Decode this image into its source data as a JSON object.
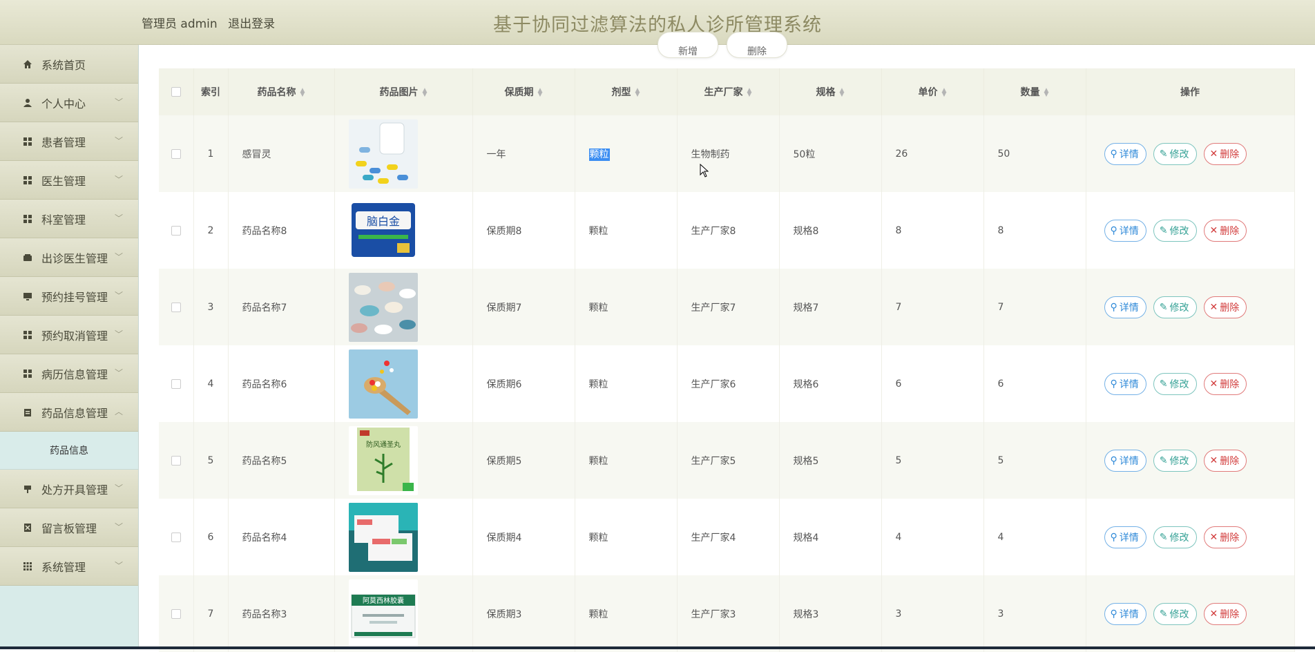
{
  "header": {
    "user_prefix": "管理员 admin",
    "logout": "退出登录",
    "title": "基于协同过滤算法的私人诊所管理系统"
  },
  "top_buttons": {
    "left": "新增",
    "right": "删除"
  },
  "sidebar": {
    "items": [
      {
        "label": "系统首页",
        "icon": "home-icon",
        "chevron": false
      },
      {
        "label": "个人中心",
        "icon": "user-icon",
        "chevron": true
      },
      {
        "label": "患者管理",
        "icon": "grid-icon",
        "chevron": true
      },
      {
        "label": "医生管理",
        "icon": "grid-icon",
        "chevron": true
      },
      {
        "label": "科室管理",
        "icon": "grid-icon",
        "chevron": true
      },
      {
        "label": "出诊医生管理",
        "icon": "wallet-icon",
        "chevron": true
      },
      {
        "label": "预约挂号管理",
        "icon": "monitor-icon",
        "chevron": true
      },
      {
        "label": "预约取消管理",
        "icon": "grid-icon",
        "chevron": true
      },
      {
        "label": "病历信息管理",
        "icon": "grid-icon",
        "chevron": true
      },
      {
        "label": "药品信息管理",
        "icon": "clipboard-icon",
        "chevron": true,
        "expanded": true
      },
      {
        "label": "处方开具管理",
        "icon": "stamp-icon",
        "chevron": true
      },
      {
        "label": "留言板管理",
        "icon": "note-icon",
        "chevron": true
      },
      {
        "label": "系统管理",
        "icon": "apps-icon",
        "chevron": true
      }
    ],
    "sub_item": "药品信息"
  },
  "table": {
    "headers": [
      "索引",
      "药品名称",
      "药品图片",
      "保质期",
      "剂型",
      "生产厂家",
      "规格",
      "单价",
      "数量",
      "操作"
    ],
    "rows": [
      {
        "idx": "1",
        "name": "感冒灵",
        "image": "capsules-bottle",
        "period": "一年",
        "form": "颗粒",
        "maker": "生物制药",
        "spec": "50粒",
        "price": "26",
        "qty": "50"
      },
      {
        "idx": "2",
        "name": "药品名称8",
        "image": "blue-box",
        "period": "保质期8",
        "form": "颗粒",
        "maker": "生产厂家8",
        "spec": "规格8",
        "price": "8",
        "qty": "8"
      },
      {
        "idx": "3",
        "name": "药品名称7",
        "image": "pills-closeup",
        "period": "保质期7",
        "form": "颗粒",
        "maker": "生产厂家7",
        "spec": "规格7",
        "price": "7",
        "qty": "7"
      },
      {
        "idx": "4",
        "name": "药品名称6",
        "image": "spoon-pills",
        "period": "保质期6",
        "form": "颗粒",
        "maker": "生产厂家6",
        "spec": "规格6",
        "price": "6",
        "qty": "6"
      },
      {
        "idx": "5",
        "name": "药品名称5",
        "image": "green-box",
        "period": "保质期5",
        "form": "颗粒",
        "maker": "生产厂家5",
        "spec": "规格5",
        "price": "5",
        "qty": "5"
      },
      {
        "idx": "6",
        "name": "药品名称4",
        "image": "teal-boxes",
        "period": "保质期4",
        "form": "颗粒",
        "maker": "生产厂家4",
        "spec": "规格4",
        "price": "4",
        "qty": "4"
      },
      {
        "idx": "7",
        "name": "药品名称3",
        "image": "white-box",
        "period": "保质期3",
        "form": "颗粒",
        "maker": "生产厂家3",
        "spec": "规格3",
        "price": "3",
        "qty": "3"
      }
    ],
    "actions": {
      "detail": "详情",
      "edit": "修改",
      "delete": "删除"
    }
  },
  "colors": {
    "header_bg": "#e2e2cc",
    "title": "#8d8a63",
    "sidebar_sub_bg": "#d8ebe9",
    "detail": "#2e89d8",
    "edit": "#34a195",
    "delete": "#d23c3c",
    "highlight": "#3b8df2"
  }
}
